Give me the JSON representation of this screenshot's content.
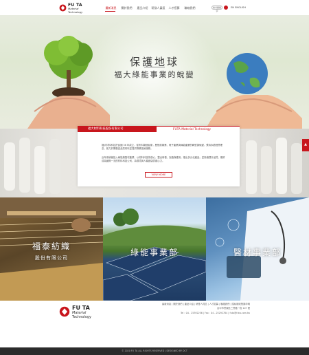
{
  "brand": {
    "name_line1": "FU TA",
    "name_line2": "Material",
    "name_line3": "Technology",
    "accent_color": "#c8161d"
  },
  "nav": {
    "items": [
      "最新消息",
      "關於我們",
      "產品介紹",
      "研發人員區",
      "人才招募",
      "聯絡我們"
    ],
    "active_index": 0,
    "search_label": "搜尋關鍵字",
    "lang_label": "EN  ENGLISH"
  },
  "hero": {
    "title": "保護地球",
    "subtitle": "福大綠能事業的蛻變"
  },
  "intro": {
    "tab_left": "福大材料科技股份有限公司",
    "tab_right": "FUTA Material Technology",
    "paragraph1": "福大材料科技於民國 56 年成立，從布料織造起家，歷經紡織業、電子產業與綠能產業的轉型與蛻變，秉持永續經營理念，致力於開發高品質材料並提供專業技術服務。",
    "paragraph2": "近年來積極投入綠能與醫材產業，以材料科技為核心，整合研發、製造與應用，推出多元化產品，並持續提升品質，期許成為國際一流的材料科技公司，為環境與人類健康貢獻心力。",
    "view_more": "VIEW MORE"
  },
  "side_button": {
    "icon": "chevron-up-icon"
  },
  "panels": [
    {
      "title": "福泰紡織",
      "subtitle": "股份有限公司"
    },
    {
      "title": "綠能事業部"
    },
    {
      "title": "醫材事業部"
    }
  ],
  "footer": {
    "links": "最新消息 | 關於我們 | 產品介紹 | 研發人員區 | 人才招募 | 聯絡我們 | 隱私權政策與申明",
    "address": "台中市豐原區三豐路一段 107 號",
    "contact": "Tel：04 - 25392256  |  Fax：04 - 25292784  |  futa@futa.com.tw",
    "copyright": "© 2020 FU TA ALL RIGHTS RESERVED  |  DESIGNED BY DCT"
  }
}
